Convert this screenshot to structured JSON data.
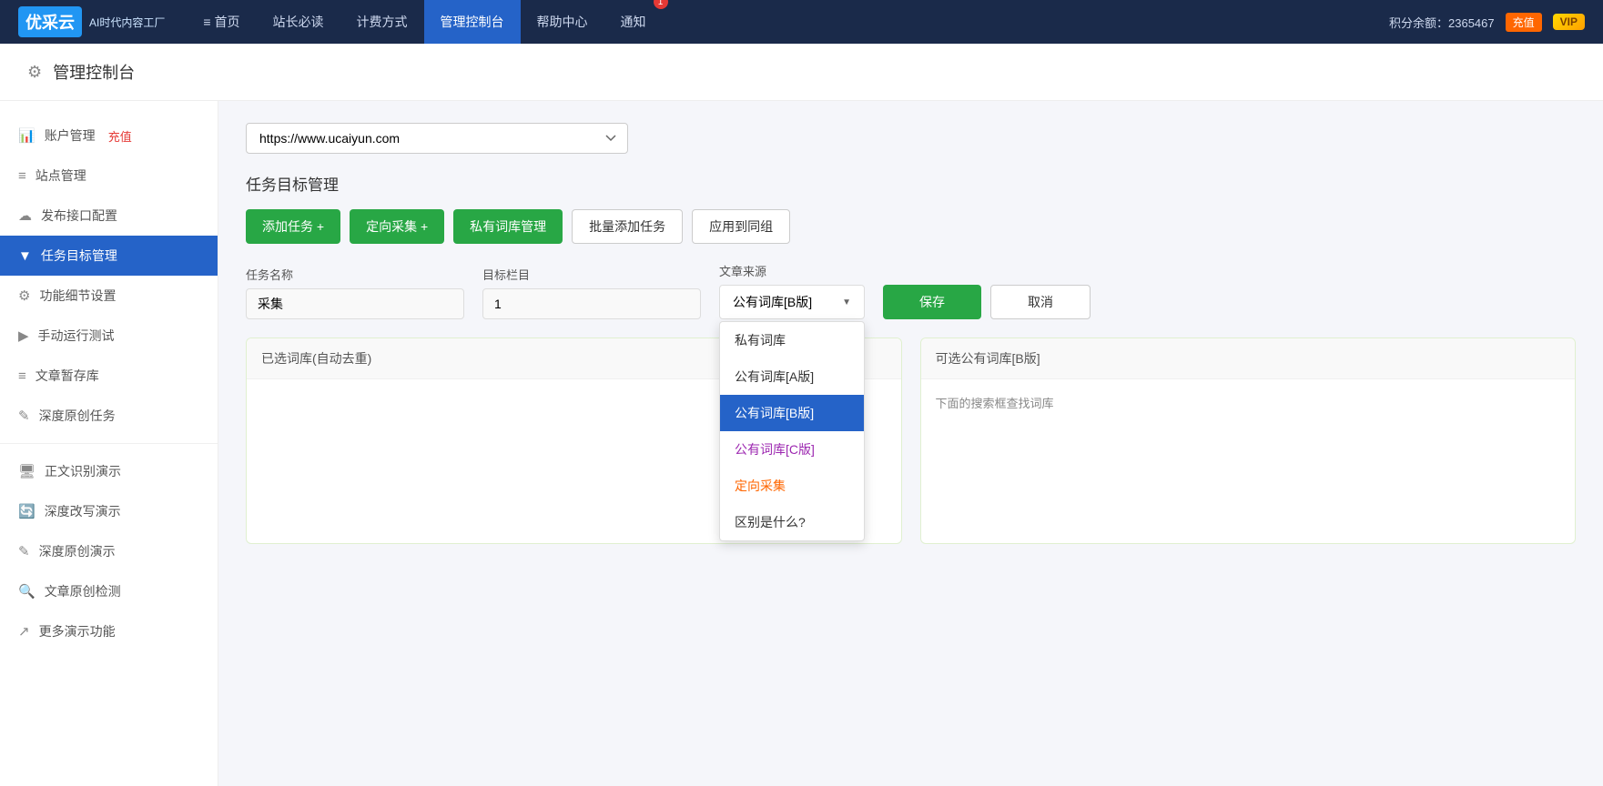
{
  "logo": {
    "text": "优采云",
    "subtitle": "AI时代内容工厂"
  },
  "nav": {
    "items": [
      {
        "id": "home",
        "label": "首页",
        "icon": "≡",
        "active": false
      },
      {
        "id": "webmaster",
        "label": "站长必读",
        "active": false
      },
      {
        "id": "pricing",
        "label": "计费方式",
        "active": false
      },
      {
        "id": "dashboard",
        "label": "管理控制台",
        "active": true
      },
      {
        "id": "help",
        "label": "帮助中心",
        "active": false
      },
      {
        "id": "notifications",
        "label": "通知",
        "badge": "1",
        "active": false
      }
    ],
    "points_label": "积分余额：",
    "points_value": "2365467",
    "recharge_label": "充值",
    "vip_label": "VIP"
  },
  "page_header": {
    "title": "管理控制台",
    "icon": "⚙"
  },
  "sidebar": {
    "items": [
      {
        "id": "account",
        "label": "账户管理",
        "extra": "充值",
        "icon": "📊"
      },
      {
        "id": "sites",
        "label": "站点管理",
        "icon": "≡"
      },
      {
        "id": "publish",
        "label": "发布接口配置",
        "icon": "☁"
      },
      {
        "id": "tasks",
        "label": "任务目标管理",
        "icon": "▼",
        "active": true
      },
      {
        "id": "settings",
        "label": "功能细节设置",
        "icon": "⚙"
      },
      {
        "id": "manual",
        "label": "手动运行测试",
        "icon": "▶"
      },
      {
        "id": "draft",
        "label": "文章暂存库",
        "icon": "≡"
      },
      {
        "id": "deeporiginal",
        "label": "深度原创任务",
        "icon": "✎"
      },
      {
        "id": "textrecog",
        "label": "正文识别演示",
        "icon": "🖥"
      },
      {
        "id": "deeprewrite",
        "label": "深度改写演示",
        "icon": "🔄"
      },
      {
        "id": "deeporigdemo",
        "label": "深度原创演示",
        "icon": "✎"
      },
      {
        "id": "plagcheck",
        "label": "文章原创检测",
        "icon": "🔍"
      },
      {
        "id": "moredemo",
        "label": "更多演示功能",
        "icon": "↗"
      }
    ]
  },
  "main": {
    "site_url": "https://www.ucaiyun.com",
    "section_title": "任务目标管理",
    "buttons": {
      "add_task": "添加任务 +",
      "directed_collect": "定向采集 +",
      "private_library": "私有词库管理",
      "batch_add": "批量添加任务",
      "apply_group": "应用到同组"
    },
    "form": {
      "task_name_label": "任务名称",
      "task_name_value": "采集",
      "target_col_label": "目标栏目",
      "target_col_value": "1",
      "source_label": "文章来源",
      "source_selected": "公有词库[B版]",
      "save_btn": "保存",
      "cancel_btn": "取消"
    },
    "dropdown": {
      "options": [
        {
          "id": "private",
          "label": "私有词库",
          "color": "default",
          "selected": false
        },
        {
          "id": "publicA",
          "label": "公有词库[A版]",
          "color": "default",
          "selected": false
        },
        {
          "id": "publicB",
          "label": "公有词库[B版]",
          "color": "blue",
          "selected": true
        },
        {
          "id": "publicC",
          "label": "公有词库[C版]",
          "color": "purple",
          "selected": false
        },
        {
          "id": "directed",
          "label": "定向采集",
          "color": "orange",
          "selected": false
        },
        {
          "id": "diff",
          "label": "区别是什么?",
          "color": "default",
          "selected": false
        }
      ]
    },
    "panels": {
      "left_title": "已选词库(自动去重)",
      "right_title": "可选公有词库[B版]",
      "right_hint": "下面的搜索框查找词库"
    }
  }
}
